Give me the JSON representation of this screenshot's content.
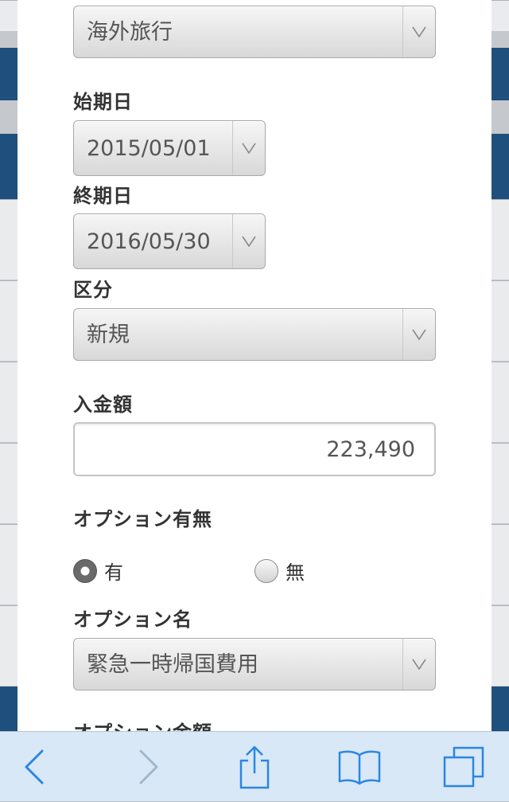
{
  "form": {
    "destination": {
      "value": "海外旅行"
    },
    "start_date": {
      "label": "始期日",
      "value": "2015/05/01"
    },
    "end_date": {
      "label": "終期日",
      "value": "2016/05/30"
    },
    "category": {
      "label": "区分",
      "value": "新規"
    },
    "payment": {
      "label": "入金額",
      "value": "223,490"
    },
    "option_presence": {
      "label": "オプション有無",
      "options": [
        {
          "label": "有",
          "checked": true
        },
        {
          "label": "無",
          "checked": false
        }
      ]
    },
    "option_name": {
      "label": "オプション名",
      "value": "緊急一時帰国費用"
    },
    "option_amount": {
      "label": "オプション金額"
    }
  },
  "toolbar": {
    "icons": [
      "back-icon",
      "forward-icon",
      "share-icon",
      "bookmarks-icon",
      "tabs-icon"
    ],
    "tint": "#2a86e3",
    "disabled_tint": "#9fb7cc",
    "background": "#d9e8f6"
  },
  "colors": {
    "background_tab": "#1f4f7c",
    "modal": "#ffffff",
    "label_text": "#333333",
    "field_text": "#555555"
  }
}
